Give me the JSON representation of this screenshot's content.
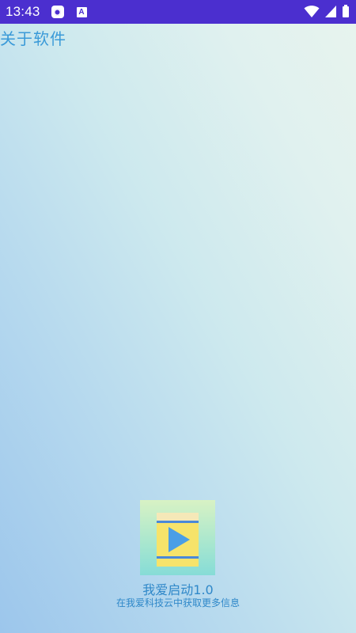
{
  "status_bar": {
    "time": "13:43",
    "notification_badge": "A",
    "icons": [
      "record-icon",
      "a-notification-icon",
      "wifi-icon",
      "cell-signal-icon",
      "battery-icon"
    ],
    "background_color": "#4b2fcf"
  },
  "page": {
    "title": "关于软件"
  },
  "app": {
    "icon_name": "play-video-icon",
    "name": "我爱启动1.0",
    "subtitle": "在我爱科技云中获取更多信息"
  },
  "colors": {
    "accent": "#3a9ad8",
    "gradient": [
      "#9cc6ec",
      "#e8f4ee"
    ]
  }
}
